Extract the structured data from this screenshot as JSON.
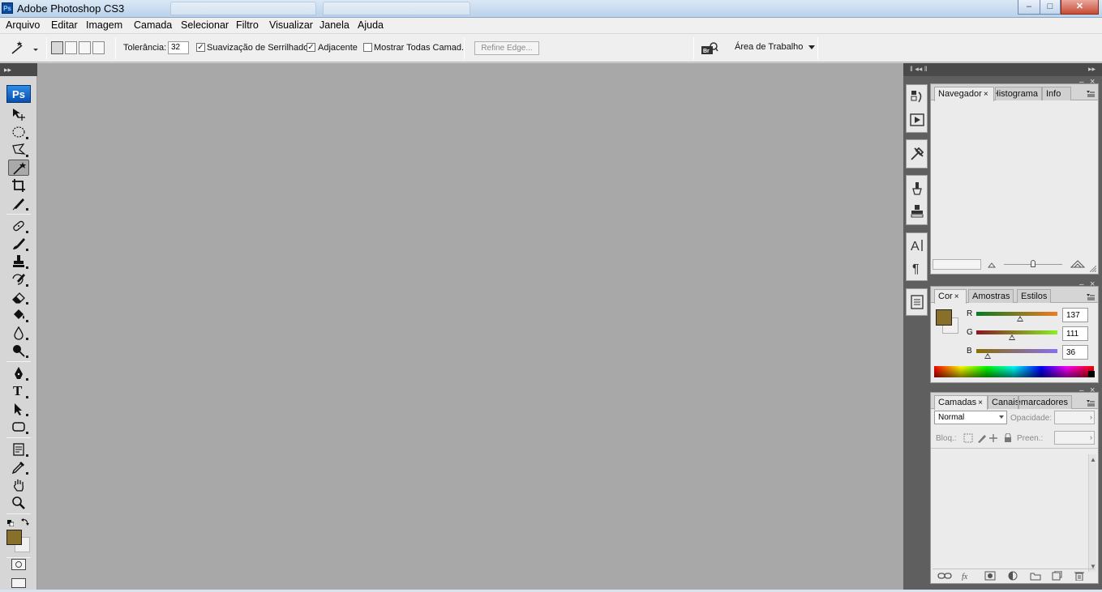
{
  "window": {
    "title": "Adobe Photoshop CS3",
    "app_icon": "Ps",
    "controls": {
      "minimize": "–",
      "maximize": "□",
      "close": "✕"
    }
  },
  "menu": {
    "items": [
      "Arquivo",
      "Editar",
      "Imagem",
      "Camada",
      "Selecionar",
      "Filtro",
      "Visualizar",
      "Janela",
      "Ajuda"
    ]
  },
  "options": {
    "tolerance_label": "Tolerância:",
    "tolerance_value": "32",
    "antialias_label": "Suavização de Serrilhado",
    "antialias_checked": "✓",
    "contiguous_label": "Adjacente",
    "contiguous_checked": "✓",
    "all_layers_label": "Mostrar Todas Camad.",
    "refine_edge_label": "Refine Edge...",
    "workspace_label": "Área de Trabalho"
  },
  "toolbox": {
    "logo": "Ps",
    "tools": [
      "move-tool",
      "marquee-tool",
      "lasso-tool",
      "magic-wand-tool",
      "crop-tool",
      "slice-tool",
      "healing-brush-tool",
      "brush-tool",
      "clone-stamp-tool",
      "history-brush-tool",
      "eraser-tool",
      "paint-bucket-tool",
      "blur-tool",
      "dodge-tool",
      "pen-tool",
      "type-tool",
      "path-selection-tool",
      "shape-tool",
      "notes-tool",
      "eyedropper-tool",
      "hand-tool",
      "zoom-tool"
    ],
    "type_glyph": "T",
    "foreground_color": "#89702a",
    "background_color": "#f2f0ee"
  },
  "panels": {
    "navigator": {
      "tabs": [
        "Navegador",
        "Histograma",
        "Info"
      ]
    },
    "color": {
      "tabs": [
        "Cor",
        "Amostras",
        "Estilos"
      ],
      "channels": [
        {
          "label": "R",
          "value": "137",
          "fraction": 0.537
        },
        {
          "label": "G",
          "value": "111",
          "fraction": 0.435
        },
        {
          "label": "B",
          "value": "36",
          "fraction": 0.141
        }
      ],
      "swatch": "#89702a"
    },
    "layers": {
      "tabs": [
        "Camadas",
        "Canais",
        "Demarcadores"
      ],
      "blend_mode": "Normal",
      "opacity_label": "Opacidade:",
      "lock_label": "Bloq.:",
      "fill_label": "Preen.:"
    },
    "close_glyph": "×"
  },
  "colors": {
    "canvas": "#a8a8a8",
    "panel_bg": "#ebebeb",
    "dock_bg": "#5f5f5f"
  }
}
